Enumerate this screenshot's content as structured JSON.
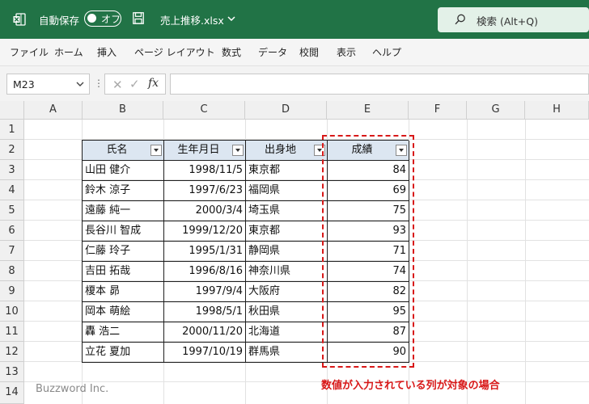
{
  "titlebar": {
    "autosave_label": "自動保存",
    "autosave_state": "オフ",
    "filename": "売上推移.xlsx",
    "search_placeholder": "検索 (Alt+Q)",
    "bg_color": "#217346"
  },
  "menu": [
    "ファイル",
    "ホーム",
    "挿入",
    "ページ レイアウト",
    "数式",
    "データ",
    "校閲",
    "表示",
    "ヘルプ"
  ],
  "formula_bar": {
    "name_box": "M23",
    "formula": ""
  },
  "columns": [
    "A",
    "B",
    "C",
    "D",
    "E",
    "F",
    "G",
    "H"
  ],
  "rows": [
    "1",
    "2",
    "3",
    "4",
    "5",
    "6",
    "7",
    "8",
    "9",
    "10",
    "11",
    "12",
    "13",
    "14"
  ],
  "table": {
    "headers": [
      "氏名",
      "生年月日",
      "出身地",
      "成績"
    ],
    "rows": [
      [
        "山田 健介",
        "1998/11/5",
        "東京都",
        "84"
      ],
      [
        "鈴木 涼子",
        "1997/6/23",
        "福岡県",
        "69"
      ],
      [
        "遠藤 純一",
        "2000/3/4",
        "埼玉県",
        "75"
      ],
      [
        "長谷川 智成",
        "1999/12/20",
        "東京都",
        "93"
      ],
      [
        "仁藤 玲子",
        "1995/1/31",
        "静岡県",
        "71"
      ],
      [
        "吉田 拓哉",
        "1996/8/16",
        "神奈川県",
        "74"
      ],
      [
        "榎本 昴",
        "1997/9/4",
        "大阪府",
        "82"
      ],
      [
        "岡本 萌絵",
        "1998/5/1",
        "秋田県",
        "95"
      ],
      [
        "轟 浩二",
        "2000/11/20",
        "北海道",
        "87"
      ],
      [
        "立花 夏加",
        "1997/10/19",
        "群馬県",
        "90"
      ]
    ]
  },
  "annotation": "数値が入力されている列が対象の場合",
  "watermark": "Buzzword Inc."
}
